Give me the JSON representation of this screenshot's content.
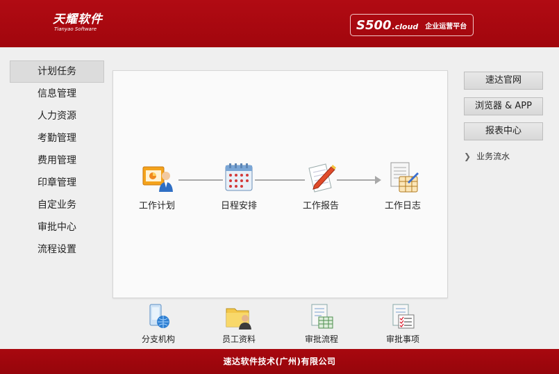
{
  "header": {
    "logo_main": "天耀软件",
    "logo_sub": "Tianyao Software",
    "brand_s500": "S500",
    "brand_cloud": ".cloud",
    "brand_text": "企业运营平台"
  },
  "sidebar": {
    "items": [
      {
        "label": "计划任务",
        "active": true
      },
      {
        "label": "信息管理"
      },
      {
        "label": "人力资源"
      },
      {
        "label": "考勤管理"
      },
      {
        "label": "费用管理"
      },
      {
        "label": "印章管理"
      },
      {
        "label": "自定业务"
      },
      {
        "label": "审批中心"
      },
      {
        "label": "流程设置"
      }
    ]
  },
  "flow": {
    "nodes": [
      {
        "label": "工作计划",
        "icon": "work-plan-icon"
      },
      {
        "label": "日程安排",
        "icon": "calendar-icon"
      },
      {
        "label": "工作报告",
        "icon": "report-icon"
      },
      {
        "label": "工作日志",
        "icon": "work-log-icon"
      }
    ]
  },
  "bottom": {
    "items": [
      {
        "label": "分支机构",
        "icon": "branch-icon"
      },
      {
        "label": "员工资料",
        "icon": "staff-folder-icon"
      },
      {
        "label": "审批流程",
        "icon": "approval-flow-icon"
      },
      {
        "label": "审批事项",
        "icon": "approval-items-icon"
      }
    ]
  },
  "right": {
    "buttons": [
      "速达官网",
      "浏览器 & APP",
      "报表中心"
    ],
    "link": "业务流水",
    "link_icon": "chevron-right-icon"
  },
  "footer": {
    "text": "速达软件技术(广州)有限公司"
  },
  "colors": {
    "header_red": "#a1060d",
    "footer_red": "#96050b",
    "background": "#efefef"
  }
}
